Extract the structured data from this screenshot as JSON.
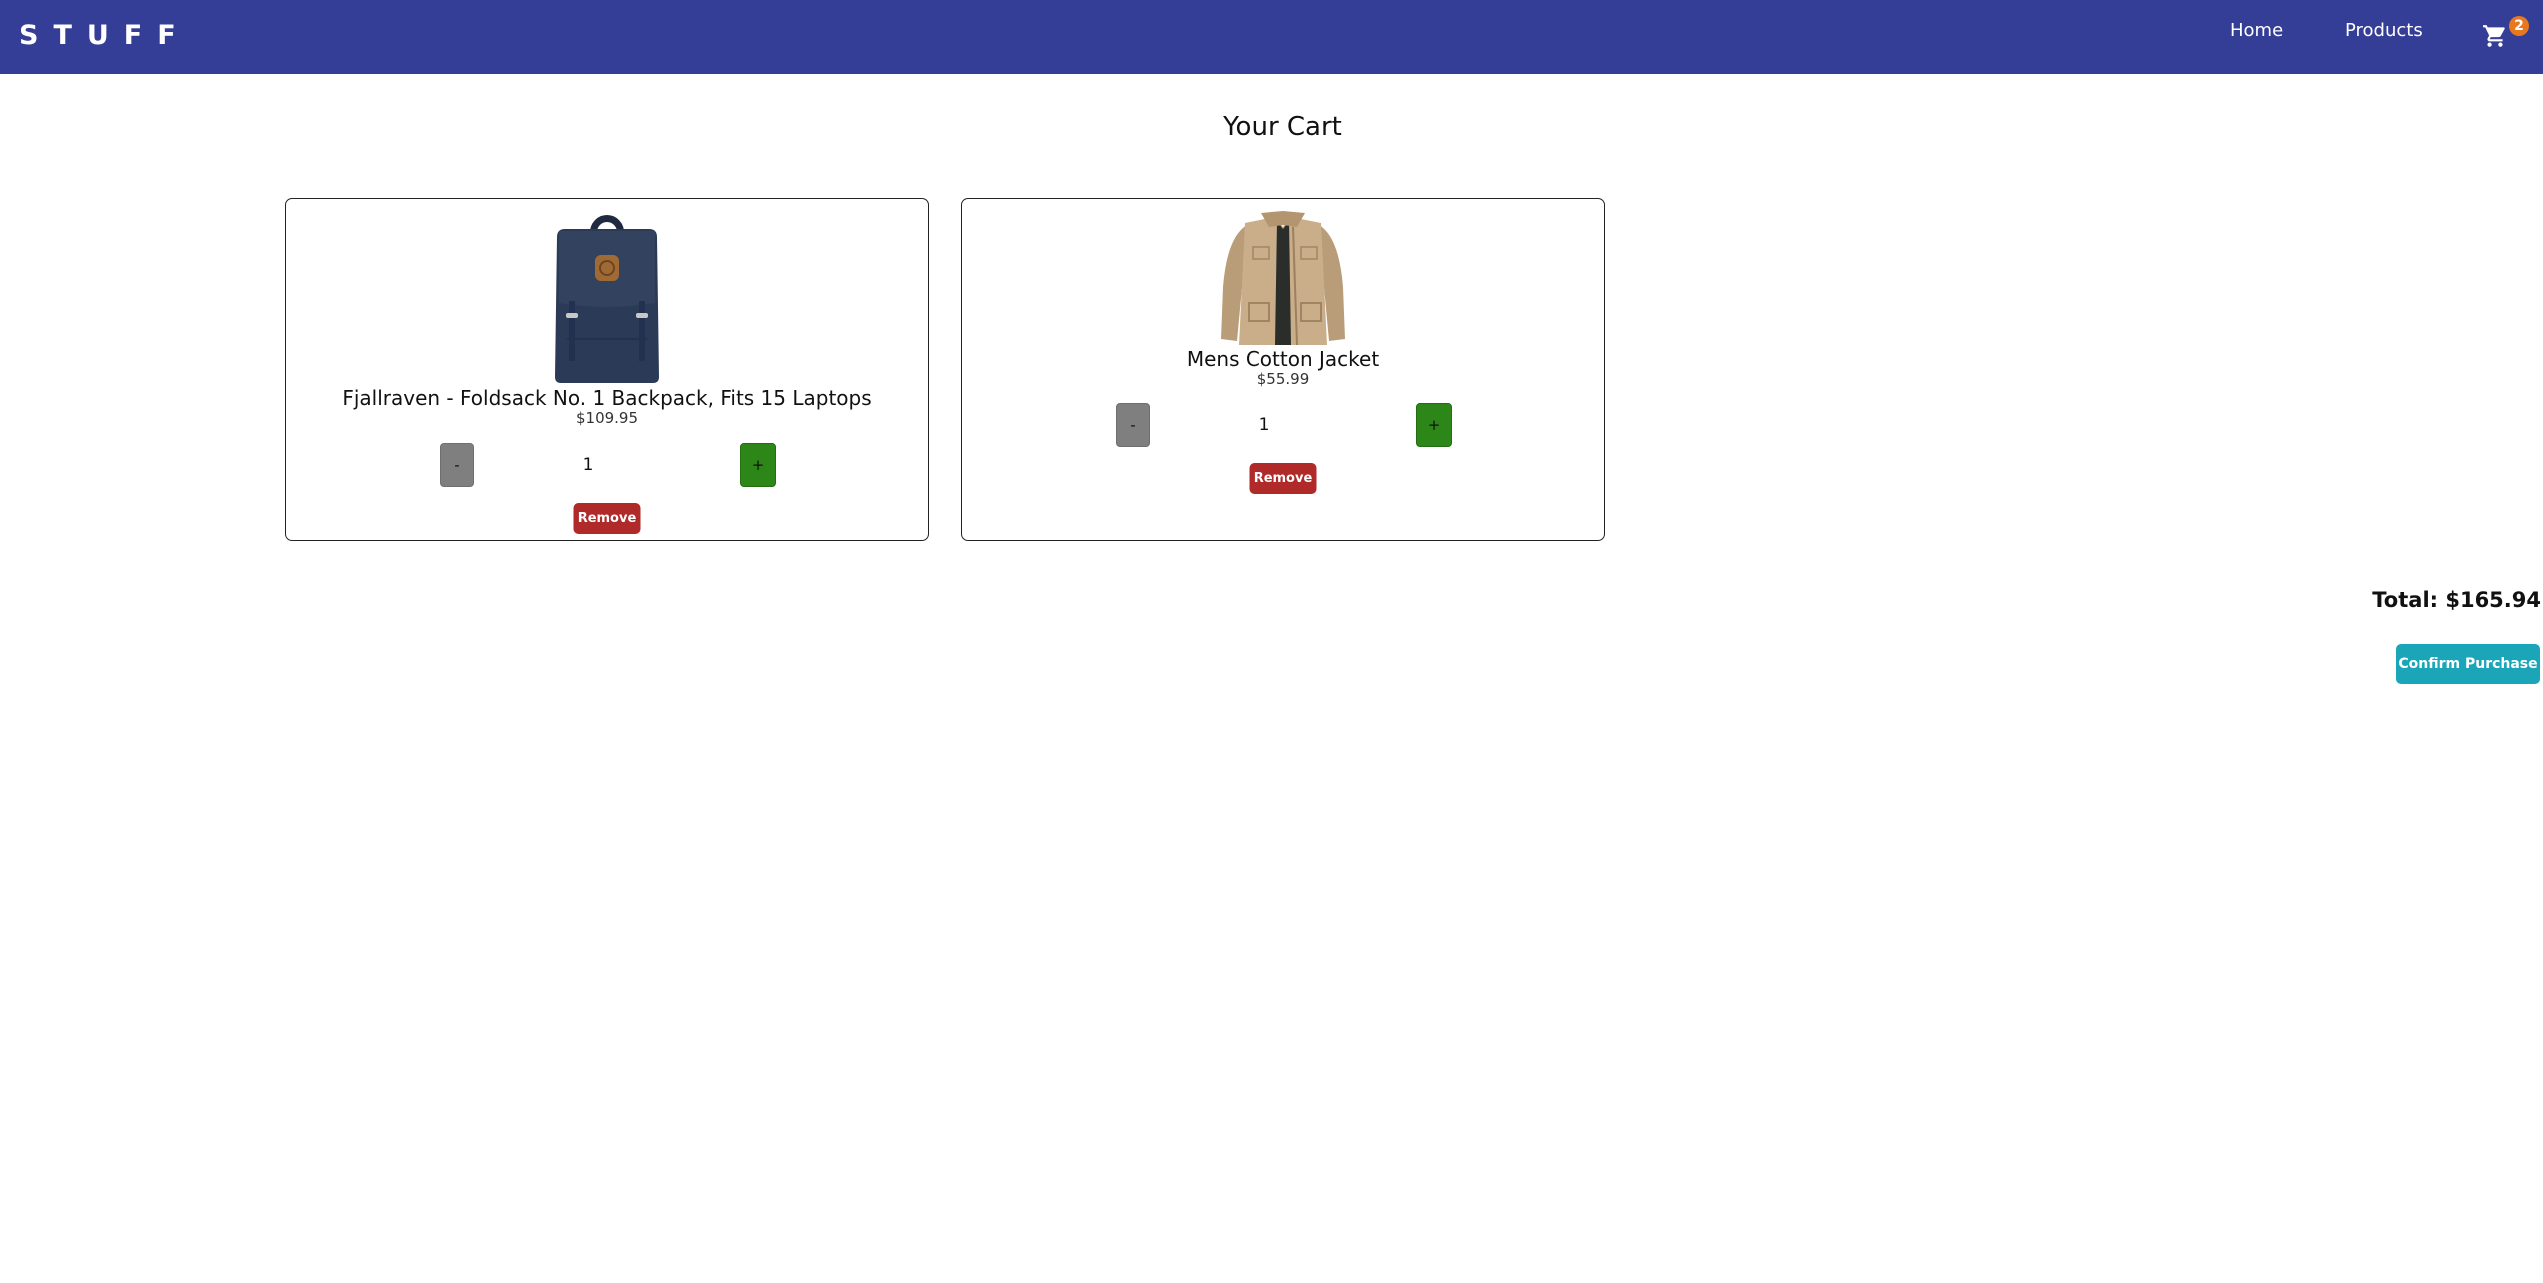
{
  "header": {
    "brand": "STUFF",
    "nav": {
      "home_label": "Home",
      "products_label": "Products"
    },
    "cart": {
      "icon": "shopping-cart-icon",
      "badge_count": "2"
    }
  },
  "main": {
    "title": "Your Cart",
    "items": [
      {
        "name": "Fjallraven - Foldsack No. 1 Backpack, Fits 15 Laptops",
        "price": "$109.95",
        "quantity": "1",
        "minus_label": "-",
        "plus_label": "+",
        "remove_label": "Remove"
      },
      {
        "name": "Mens Cotton Jacket",
        "price": "$55.99",
        "quantity": "1",
        "minus_label": "-",
        "plus_label": "+",
        "remove_label": "Remove"
      }
    ],
    "total_text": "Total: $165.94",
    "confirm_label": "Confirm Purchase"
  },
  "colors": {
    "navbar": "#343e97",
    "badge": "#e8781f",
    "minus_button": "#7f7f7f",
    "plus_button": "#2c8718",
    "remove_button": "#b02a2a",
    "confirm_button": "#1aa6b8"
  }
}
